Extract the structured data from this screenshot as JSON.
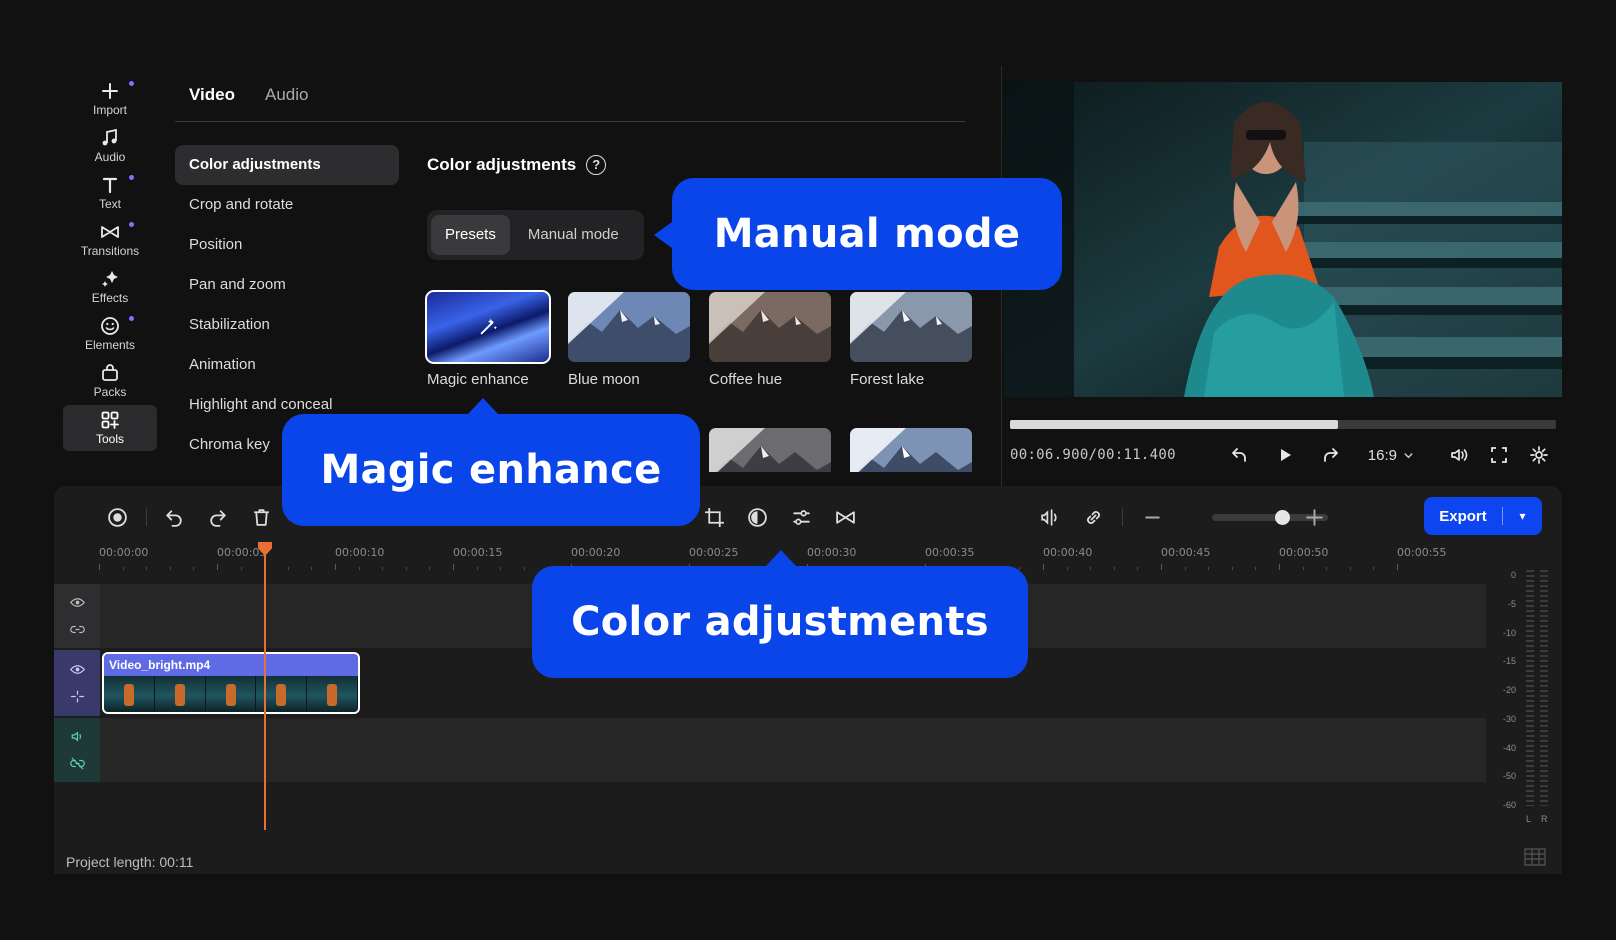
{
  "rail": [
    {
      "label": "Import",
      "icon": "plus-icon",
      "dot": true
    },
    {
      "label": "Audio",
      "icon": "music-note-icon",
      "dot": false
    },
    {
      "label": "Text",
      "icon": "text-icon",
      "dot": true
    },
    {
      "label": "Transitions",
      "icon": "bowtie-icon",
      "dot": true
    },
    {
      "label": "Effects",
      "icon": "sparkle-icon",
      "dot": false
    },
    {
      "label": "Elements",
      "icon": "smiley-icon",
      "dot": true
    },
    {
      "label": "Packs",
      "icon": "bag-icon",
      "dot": false
    },
    {
      "label": "Tools",
      "icon": "grid-plus-icon",
      "dot": false,
      "active": true
    }
  ],
  "tabs": [
    "Video",
    "Audio"
  ],
  "menu": [
    "Color adjustments",
    "Crop and rotate",
    "Position",
    "Pan and zoom",
    "Stabilization",
    "Animation",
    "Highlight and conceal",
    "Chroma key"
  ],
  "panel": {
    "title": "Color adjustments",
    "help": "?",
    "modes": [
      "Presets",
      "Manual mode"
    ],
    "presets": [
      "Magic enhance",
      "Blue moon",
      "Coffee hue",
      "Forest lake"
    ]
  },
  "player": {
    "current": "00:06.900",
    "total": "00:11.400",
    "timecode": "00:06.900/00:11.400",
    "progress": 0.6,
    "ratio": "16:9"
  },
  "toolbar": {
    "export_label": "Export",
    "zoom_level": 0.6
  },
  "ruler": [
    "00:00:00",
    "00:00:05",
    "00:00:10",
    "00:00:15",
    "00:00:20",
    "00:00:25",
    "00:00:30",
    "00:00:35",
    "00:00:40",
    "00:00:45",
    "00:00:50",
    "00:00:55"
  ],
  "clip": {
    "name": "Video_bright.mp4"
  },
  "meter": {
    "levels": [
      "0",
      "-5",
      "-10",
      "-15",
      "-20",
      "-30",
      "-40",
      "-50",
      "-60"
    ],
    "channels": [
      "L",
      "R"
    ]
  },
  "project_length": "Project length: 00:11",
  "callouts": {
    "manual": "Manual mode",
    "magic": "Magic enhance",
    "color": "Color adjustments"
  },
  "colors": {
    "accent": "#0a45ea",
    "playhead": "#e87032",
    "export": "#0d46f0"
  }
}
